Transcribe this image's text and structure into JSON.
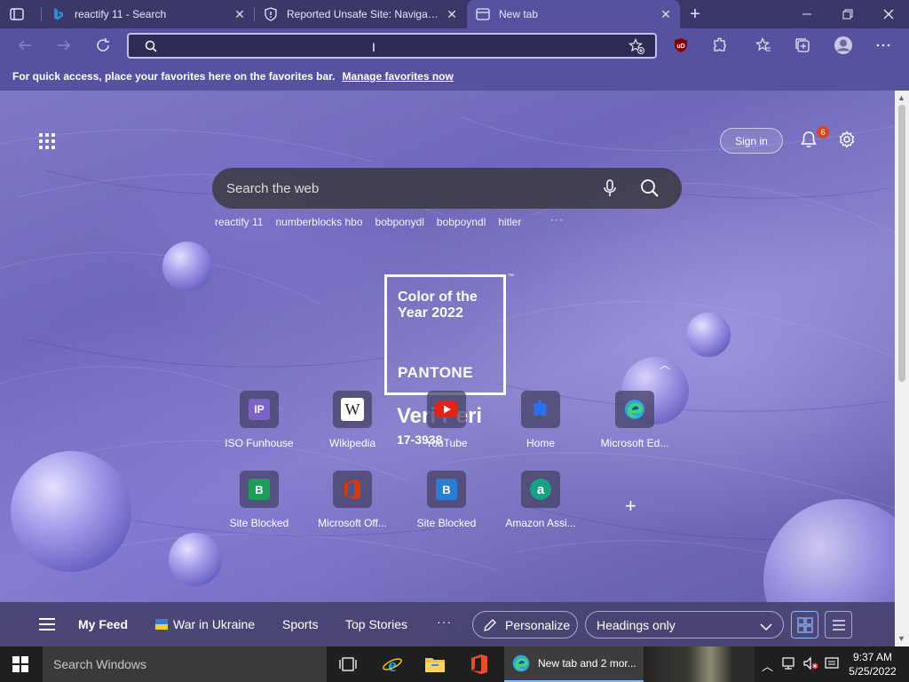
{
  "browser": {
    "tabs": [
      {
        "title": "reactify 11 - Search",
        "active": false,
        "icon": "bing-icon"
      },
      {
        "title": "Reported Unsafe Site: Navigation",
        "active": false,
        "icon": "shield-warning-icon"
      },
      {
        "title": "New tab",
        "active": true,
        "icon": "newtab-icon"
      }
    ],
    "address_bar": {
      "value": "",
      "placeholder": ""
    },
    "favorites_bar": {
      "message": "For quick access, place your favorites here on the favorites bar.",
      "link": "Manage favorites now"
    },
    "extensions": [
      "ublock-origin-icon",
      "extensions-icon",
      "favorites-icon",
      "collections-icon",
      "profile-icon",
      "more-icon"
    ]
  },
  "newtab": {
    "signin": "Sign in",
    "notifications_count": "6",
    "search_placeholder": "Search the web",
    "trending": [
      "reactify 11",
      "numberblocks hbo",
      "bobponydl",
      "bobpoyndl",
      "hitler"
    ],
    "more": "···",
    "pantone": {
      "heading": "Color of the Year 2022",
      "brand": "PANTONE",
      "tm": "™",
      "name": "Veri Peri",
      "code": "17-3938"
    },
    "tiles": [
      {
        "label": "ISO Funhouse",
        "icon": "iso-funhouse-icon",
        "letter": "IP",
        "color": "#7b63c8"
      },
      {
        "label": "Wikipedia",
        "icon": "wikipedia-icon",
        "letter": "W",
        "color": "#ffffff"
      },
      {
        "label": "YouTube",
        "icon": "youtube-icon",
        "letter": "",
        "color": "#e62117"
      },
      {
        "label": "Home",
        "icon": "home-puzzle-icon",
        "letter": "",
        "color": "#2c6ff0"
      },
      {
        "label": "Microsoft Ed...",
        "icon": "edge-icon",
        "letter": "",
        "color": "#2ea8d8"
      },
      {
        "label": "Site Blocked",
        "icon": "site-blocked-icon",
        "letter": "B",
        "color": "#1e9c5a"
      },
      {
        "label": "Microsoft Off...",
        "icon": "office-icon",
        "letter": "",
        "color": "#d83b01"
      },
      {
        "label": "Site Blocked",
        "icon": "site-blocked-icon",
        "letter": "B",
        "color": "#2b7cd3"
      },
      {
        "label": "Amazon Assi...",
        "icon": "amazon-assistant-icon",
        "letter": "a",
        "color": "#16a085"
      }
    ],
    "feed": {
      "nav": [
        "My Feed",
        "War in Ukraine",
        "Sports",
        "Top Stories"
      ],
      "more": "···",
      "personalize": "Personalize",
      "layout_select": "Headings only"
    }
  },
  "taskbar": {
    "search_placeholder": "Search Windows",
    "active_window": "New tab and 2 mor...",
    "time": "9:37 AM",
    "date": "5/25/2022"
  },
  "colors": {
    "accent": "#5652a0",
    "tabstrip": "#3b3768",
    "pantone_veri_peri": "#6667ab"
  }
}
